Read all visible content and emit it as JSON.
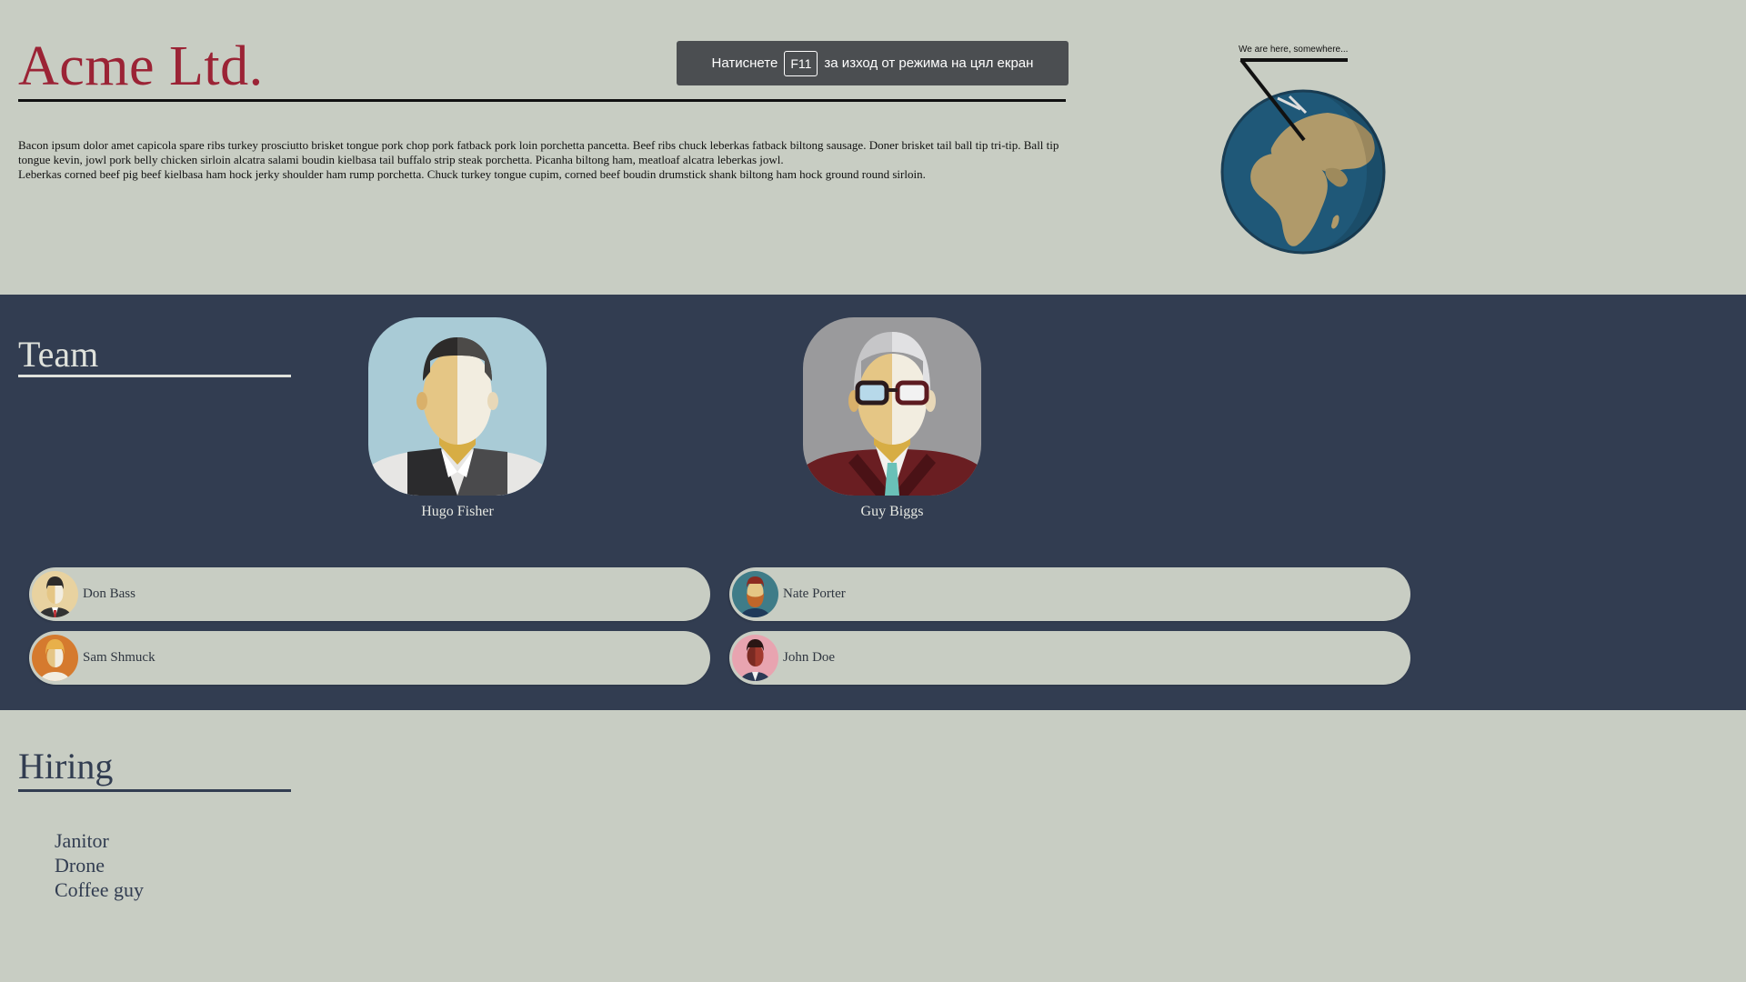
{
  "header": {
    "brand": "Acme Ltd.",
    "intro_lines": [
      "Bacon ipsum dolor amet capicola spare ribs turkey prosciutto brisket tongue pork chop pork fatback pork loin porchetta pancetta. Beef ribs chuck leberkas fatback biltong sausage. Doner brisket tail ball tip tri-tip. Ball tip tongue kevin, jowl pork belly chicken sirloin alcatra salami boudin kielbasa tail buffalo strip steak porchetta. Picanha biltong ham, meatloaf alcatra leberkas jowl.",
      "Leberkas corned beef pig beef kielbasa ham hock jerky shoulder ham rump porchetta. Chuck turkey tongue cupim, corned beef boudin drumstick shank biltong ham hock ground round sirloin."
    ],
    "globe_caption": "We are here, somewhere..."
  },
  "fullscreen_hint": {
    "before": "Натиснете",
    "key": "F11",
    "after": "за изход от режима на цял екран"
  },
  "team": {
    "title": "Team",
    "leads": [
      {
        "name": "Hugo Fisher",
        "avatar": "man-black-hair-vest-avatar"
      },
      {
        "name": "Guy Biggs",
        "avatar": "man-grey-hair-glasses-avatar"
      }
    ],
    "members": [
      {
        "name": "Don Bass",
        "avatar": "man-tie-avatar"
      },
      {
        "name": "Nate Porter",
        "avatar": "bearded-man-avatar"
      },
      {
        "name": "Sam Shmuck",
        "avatar": "blonde-man-avatar"
      },
      {
        "name": "John Doe",
        "avatar": "dark-man-avatar"
      }
    ]
  },
  "hiring": {
    "title": "Hiring",
    "positions": [
      "Janitor",
      "Drone",
      "Coffee guy"
    ]
  },
  "colors": {
    "page_bg": "#c8cdc3",
    "team_bg": "#323d51",
    "brand": "#9b2335",
    "hint_bg": "#4b4e51"
  }
}
